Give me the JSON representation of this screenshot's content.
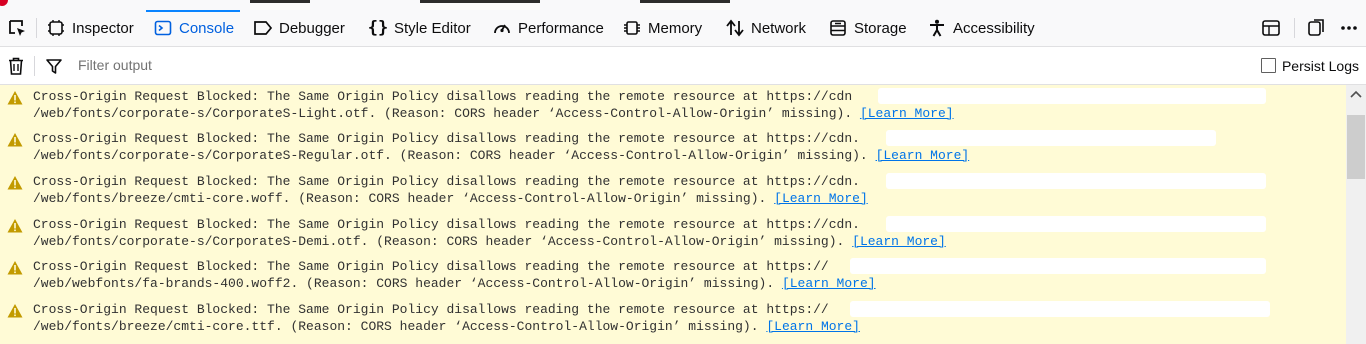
{
  "toolbar": {
    "tabs": [
      {
        "label": "Inspector",
        "icon": "inspector-icon"
      },
      {
        "label": "Console",
        "icon": "console-icon",
        "selected": true
      },
      {
        "label": "Debugger",
        "icon": "debugger-icon"
      },
      {
        "label": "Style Editor",
        "icon": "style-editor-icon"
      },
      {
        "label": "Performance",
        "icon": "performance-icon"
      },
      {
        "label": "Memory",
        "icon": "memory-icon"
      },
      {
        "label": "Network",
        "icon": "network-icon"
      },
      {
        "label": "Storage",
        "icon": "storage-icon"
      },
      {
        "label": "Accessibility",
        "icon": "accessibility-icon"
      }
    ],
    "accent_color": "#0a84ff"
  },
  "filterbar": {
    "placeholder": "Filter output",
    "persist_logs_label": "Persist Logs",
    "persist_logs_checked": false
  },
  "console": {
    "background": "#fffbd6",
    "learn_more_label": "[Learn More]",
    "messages": [
      {
        "line1": "Cross-Origin Request Blocked: The Same Origin Policy disallows reading the remote resource at https://cdn",
        "line2": "/web/fonts/corporate-s/CorporateS-Light.otf. (Reason: CORS header ‘Access-Control-Allow-Origin’ missing)."
      },
      {
        "line1": "Cross-Origin Request Blocked: The Same Origin Policy disallows reading the remote resource at https://cdn.",
        "line2": "/web/fonts/corporate-s/CorporateS-Regular.otf. (Reason: CORS header ‘Access-Control-Allow-Origin’ missing)."
      },
      {
        "line1": "Cross-Origin Request Blocked: The Same Origin Policy disallows reading the remote resource at https://cdn.",
        "line2": "/web/fonts/breeze/cmti-core.woff. (Reason: CORS header ‘Access-Control-Allow-Origin’ missing)."
      },
      {
        "line1": "Cross-Origin Request Blocked: The Same Origin Policy disallows reading the remote resource at https://cdn.",
        "line2": "/web/fonts/corporate-s/CorporateS-Demi.otf. (Reason: CORS header ‘Access-Control-Allow-Origin’ missing)."
      },
      {
        "line1": "Cross-Origin Request Blocked: The Same Origin Policy disallows reading the remote resource at https://",
        "line2": "/web/webfonts/fa-brands-400.woff2. (Reason: CORS header ‘Access-Control-Allow-Origin’ missing)."
      },
      {
        "line1": "Cross-Origin Request Blocked: The Same Origin Policy disallows reading the remote resource at https://",
        "line2": "/web/fonts/breeze/cmti-core.ttf. (Reason: CORS header ‘Access-Control-Allow-Origin’ missing)."
      }
    ]
  }
}
